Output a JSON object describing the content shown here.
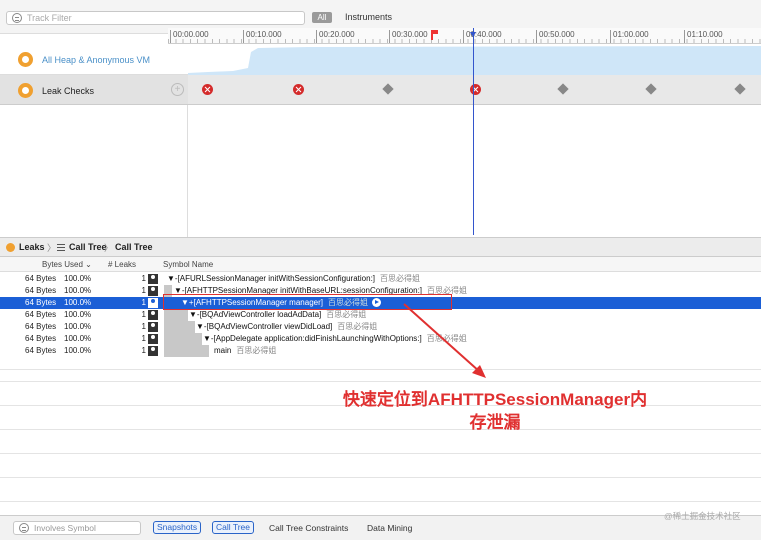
{
  "toolbar": {
    "track_filter_placeholder": "Track Filter",
    "all_label": "All",
    "instruments_label": "Instruments"
  },
  "ruler": {
    "ticks": [
      "00:00.000",
      "00:10.000",
      "00:20.000",
      "00:30.000",
      "00:40.000",
      "00:50.000",
      "01:00.000",
      "01:10.000"
    ]
  },
  "tracks": [
    {
      "name": "All Heap & Anonymous VM"
    },
    {
      "name": "Leak Checks",
      "markers": [
        "leak",
        "leak",
        "no-leak",
        "leak",
        "no-leak",
        "no-leak",
        "no-leak",
        "no-leak"
      ]
    }
  ],
  "breadcrumb": {
    "items": [
      "Leaks",
      "Call Tree",
      "Call Tree"
    ]
  },
  "table": {
    "headers": {
      "bytes_used": "Bytes Used",
      "leaks": "# Leaks",
      "symbol": "Symbol Name"
    },
    "rows": [
      {
        "bytes": "64 Bytes",
        "pct": "100.0%",
        "leaks": "1",
        "symbol": "▼-[AFURLSessionManager initWithSessionConfiguration:]",
        "lib": "百思必得姐",
        "depth": 0,
        "selected": false
      },
      {
        "bytes": "64 Bytes",
        "pct": "100.0%",
        "leaks": "1",
        "symbol": "▼-[AFHTTPSessionManager initWithBaseURL:sessionConfiguration:]",
        "lib": "百思必得姐",
        "depth": 1,
        "selected": false
      },
      {
        "bytes": "64 Bytes",
        "pct": "100.0%",
        "leaks": "1",
        "symbol": "▼+[AFHTTPSessionManager manager]",
        "lib": "百思必得姐",
        "depth": 2,
        "selected": true
      },
      {
        "bytes": "64 Bytes",
        "pct": "100.0%",
        "leaks": "1",
        "symbol": "▼-[BQAdViewController loadAdData]",
        "lib": "百思必得姐",
        "depth": 3,
        "selected": false
      },
      {
        "bytes": "64 Bytes",
        "pct": "100.0%",
        "leaks": "1",
        "symbol": "▼-[BQAdViewController viewDidLoad]",
        "lib": "百思必得姐",
        "depth": 4,
        "selected": false
      },
      {
        "bytes": "64 Bytes",
        "pct": "100.0%",
        "leaks": "1",
        "symbol": "▼-[AppDelegate application:didFinishLaunchingWithOptions:]",
        "lib": "百思必得姐",
        "depth": 5,
        "selected": false
      },
      {
        "bytes": "64 Bytes",
        "pct": "100.0%",
        "leaks": "1",
        "symbol": "main",
        "lib": "百思必得姐",
        "depth": 6,
        "selected": false
      }
    ]
  },
  "annotation": {
    "line1": "快速定位到AFHTTPSessionManager内",
    "line2": "存泄漏",
    "color": "#e03030"
  },
  "bottombar": {
    "involves_placeholder": "Involves Symbol",
    "snapshots_label": "Snapshots",
    "call_tree_label": "Call Tree",
    "constraints_label": "Call Tree Constraints",
    "data_mining_label": "Data Mining"
  },
  "watermark": "@稀土掘金技术社区",
  "colors": {
    "selection": "#1b5fd6",
    "heap_fill": "#cfe6f8",
    "leak": "#d42b2b",
    "accent": "#f0a030"
  }
}
